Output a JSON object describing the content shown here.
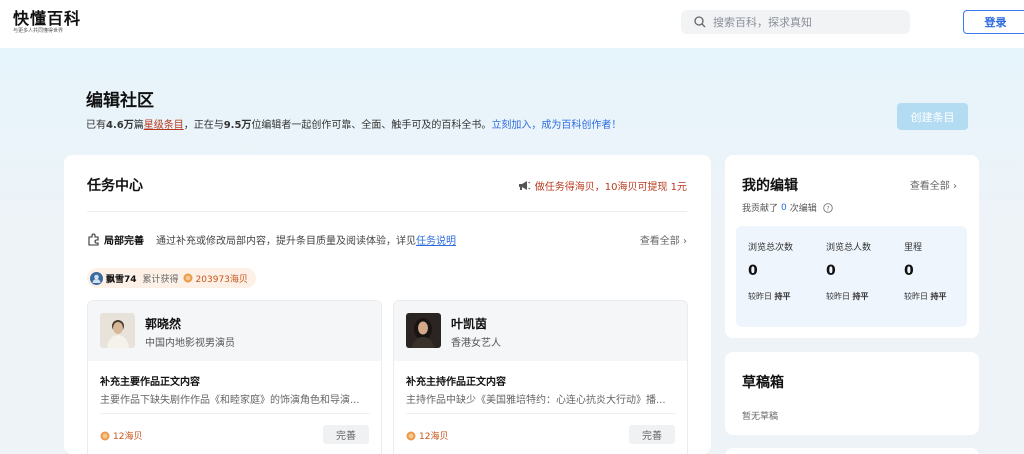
{
  "header": {
    "logo_title": "快懂百科",
    "logo_subtitle": "与更多人共同懂得世界",
    "search_placeholder": "搜索百科，探求真知",
    "login_label": "登录"
  },
  "hero": {
    "title": "编辑社区",
    "desc_prefix": "已有",
    "entry_count": "4.6万",
    "desc_mid1": "篇",
    "star_entry": "星级条目",
    "desc_mid2": "，正在与",
    "editor_count": "9.5万",
    "desc_mid3": "位编辑者一起创作可靠、全面、触手可及的百科全书。",
    "join_link": "立刻加入，成为百科创作者！",
    "create_button": "创建条目"
  },
  "task_center": {
    "title": "任务中心",
    "promo": "做任务得海贝，10海贝可提现 1元",
    "section_name": "局部完善",
    "section_desc": "通过补充或修改局部内容，提升条目质量及阅读体验，详见",
    "section_link": "任务说明",
    "view_all": "查看全部",
    "user": {
      "name": "飘雪74",
      "earned_label": "累计获得",
      "earned_value": "203973海贝"
    },
    "cards": [
      {
        "name": "郭晓然",
        "role": "中国内地影视男演员",
        "task": "补充主要作品正文内容",
        "desc": "主要作品下缺失剧作作品《和睦家庭》的饰演角色和导演...",
        "reward": "12海贝",
        "button": "完善"
      },
      {
        "name": "叶凯茵",
        "role": "香港女艺人",
        "task": "补充主持作品正文内容",
        "desc": "主持作品中缺少《美国雅培特约：心连心抗炎大行动》播...",
        "reward": "12海贝",
        "button": "完善"
      }
    ]
  },
  "my_edits": {
    "title": "我的编辑",
    "view_all": "查看全部",
    "contrib_prefix": "我贡献了",
    "contrib_count": "0",
    "contrib_suffix": "次编辑",
    "stats": [
      {
        "label": "浏览总次数",
        "value": "0",
        "cmp_prefix": "较昨日",
        "cmp_value": "持平"
      },
      {
        "label": "浏览总人数",
        "value": "0",
        "cmp_prefix": "较昨日",
        "cmp_value": "持平"
      },
      {
        "label": "里程",
        "value": "0",
        "cmp_prefix": "较昨日",
        "cmp_value": "持平"
      }
    ]
  },
  "drafts": {
    "title": "草稿箱",
    "empty": "暂无草稿"
  }
}
